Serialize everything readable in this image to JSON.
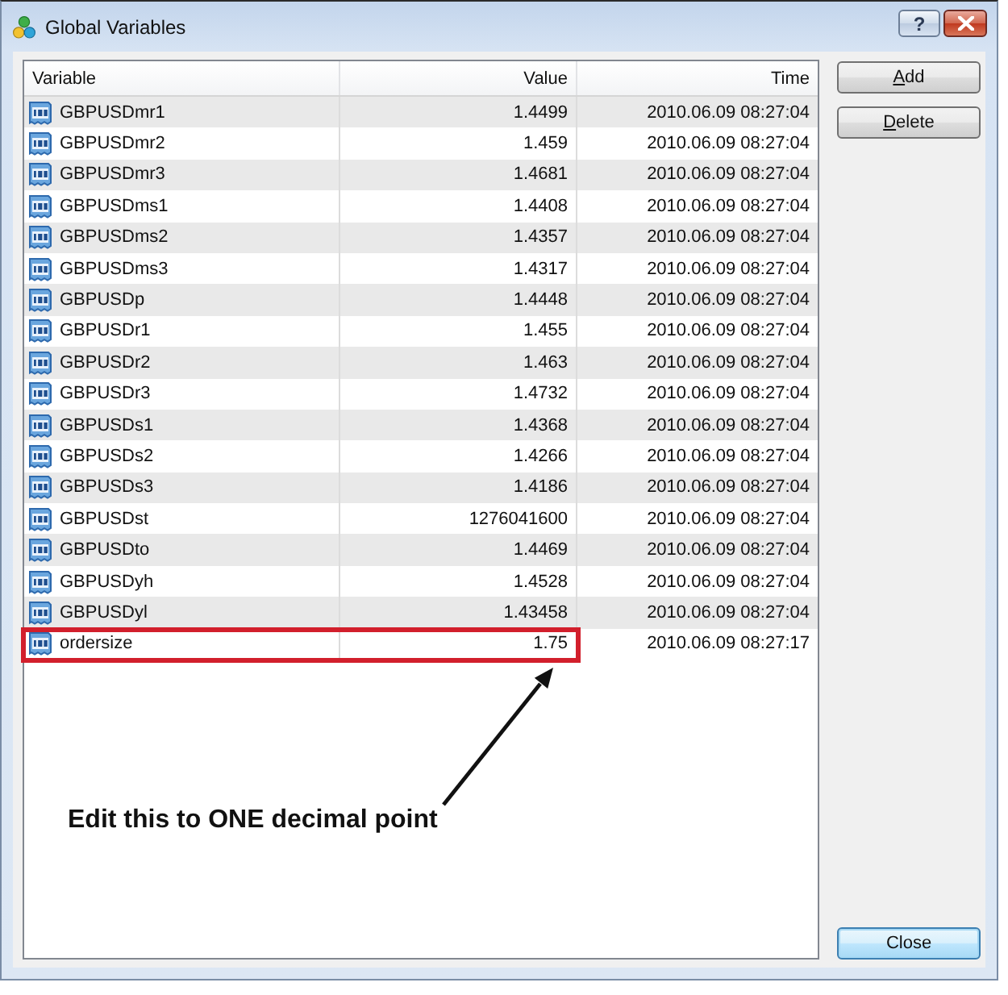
{
  "window": {
    "title": "Global Variables",
    "controls": [
      {
        "kind": "help",
        "label": "?"
      },
      {
        "kind": "close"
      }
    ]
  },
  "table": {
    "columns": [
      "Variable",
      "Value",
      "Time"
    ],
    "rows": [
      {
        "variable": "GBPUSDmr1",
        "value": "1.4499",
        "time": "2010.06.09 08:27:04",
        "highlighted": false
      },
      {
        "variable": "GBPUSDmr2",
        "value": "1.459",
        "time": "2010.06.09 08:27:04",
        "highlighted": false
      },
      {
        "variable": "GBPUSDmr3",
        "value": "1.4681",
        "time": "2010.06.09 08:27:04",
        "highlighted": false
      },
      {
        "variable": "GBPUSDms1",
        "value": "1.4408",
        "time": "2010.06.09 08:27:04",
        "highlighted": false
      },
      {
        "variable": "GBPUSDms2",
        "value": "1.4357",
        "time": "2010.06.09 08:27:04",
        "highlighted": false
      },
      {
        "variable": "GBPUSDms3",
        "value": "1.4317",
        "time": "2010.06.09 08:27:04",
        "highlighted": false
      },
      {
        "variable": "GBPUSDp",
        "value": "1.4448",
        "time": "2010.06.09 08:27:04",
        "highlighted": false
      },
      {
        "variable": "GBPUSDr1",
        "value": "1.455",
        "time": "2010.06.09 08:27:04",
        "highlighted": false
      },
      {
        "variable": "GBPUSDr2",
        "value": "1.463",
        "time": "2010.06.09 08:27:04",
        "highlighted": false
      },
      {
        "variable": "GBPUSDr3",
        "value": "1.4732",
        "time": "2010.06.09 08:27:04",
        "highlighted": false
      },
      {
        "variable": "GBPUSDs1",
        "value": "1.4368",
        "time": "2010.06.09 08:27:04",
        "highlighted": false
      },
      {
        "variable": "GBPUSDs2",
        "value": "1.4266",
        "time": "2010.06.09 08:27:04",
        "highlighted": false
      },
      {
        "variable": "GBPUSDs3",
        "value": "1.4186",
        "time": "2010.06.09 08:27:04",
        "highlighted": false
      },
      {
        "variable": "GBPUSDst",
        "value": "1276041600",
        "time": "2010.06.09 08:27:04",
        "highlighted": false
      },
      {
        "variable": "GBPUSDto",
        "value": "1.4469",
        "time": "2010.06.09 08:27:04",
        "highlighted": false
      },
      {
        "variable": "GBPUSDyh",
        "value": "1.4528",
        "time": "2010.06.09 08:27:04",
        "highlighted": false
      },
      {
        "variable": "GBPUSDyl",
        "value": "1.43458",
        "time": "2010.06.09 08:27:04",
        "highlighted": false
      },
      {
        "variable": "ordersize",
        "value": "1.75",
        "time": "2010.06.09 08:27:17",
        "highlighted": true
      }
    ]
  },
  "annotation": {
    "text": "Edit this to ONE decimal point"
  },
  "top_buttons": [
    {
      "label": "Add",
      "mnemonic": true,
      "default": false
    },
    {
      "label": "Delete",
      "mnemonic": true,
      "default": false
    }
  ],
  "bottom_buttons": [
    {
      "label": "Close",
      "mnemonic": false,
      "default": true
    }
  ]
}
